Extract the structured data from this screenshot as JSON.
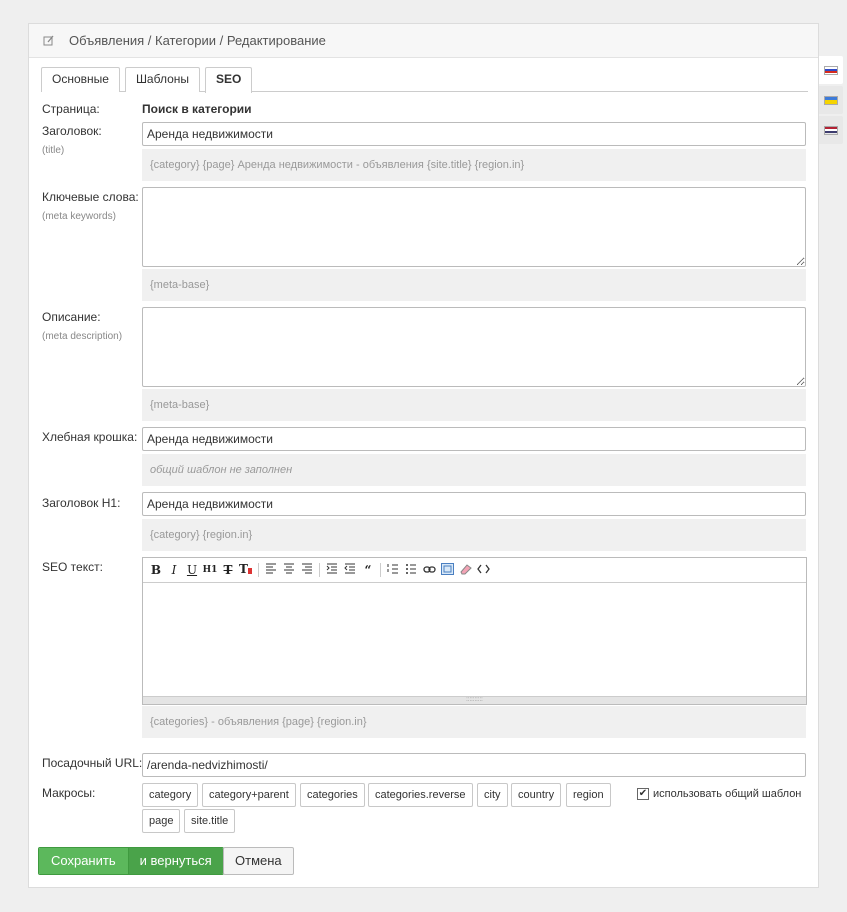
{
  "header": {
    "breadcrumb": "Объявления / Категории / Редактирование"
  },
  "tabs": [
    {
      "label": "Основные"
    },
    {
      "label": "Шаблоны"
    },
    {
      "label": "SEO",
      "active": true
    }
  ],
  "form": {
    "page": {
      "label": "Страница:",
      "value": "Поиск в категории"
    },
    "title": {
      "label": "Заголовок:",
      "sublabel": "(title)",
      "value": "Аренда недвижимости",
      "hint": "{category} {page} Аренда недвижимости - объявления {site.title} {region.in}"
    },
    "keywords": {
      "label": "Ключевые слова:",
      "sublabel": "(meta keywords)",
      "value": "",
      "hint": "{meta-base}"
    },
    "description": {
      "label": "Описание:",
      "sublabel": "(meta description)",
      "value": "",
      "hint": "{meta-base}"
    },
    "breadcrumb": {
      "label": "Хлебная крошка:",
      "value": "Аренда недвижимости",
      "hint": "общий шаблон не заполнен"
    },
    "h1": {
      "label": "Заголовок H1:",
      "value": "Аренда недвижимости",
      "hint": "{category} {region.in}"
    },
    "seo_text": {
      "label": "SEO текст:",
      "hint": "{categories} - объявления {page} {region.in}"
    },
    "url": {
      "label": "Посадочный URL:",
      "value": "/arenda-nedvizhimosti/"
    },
    "macros": {
      "label": "Макросы:",
      "items": [
        "category",
        "category+parent",
        "categories",
        "categories.reverse",
        "city",
        "country",
        "region",
        "page",
        "site.title"
      ],
      "use_common_label": "использовать общий шаблон",
      "use_common_checked": true
    }
  },
  "toolbar_icons": [
    "bold-icon",
    "italic-icon",
    "underline-icon",
    "heading-icon",
    "strikethrough-icon",
    "text-color-icon",
    "align-left-icon",
    "align-center-icon",
    "align-right-icon",
    "indent-icon",
    "outdent-icon",
    "quote-icon",
    "ordered-list-icon",
    "unordered-list-icon",
    "link-icon",
    "fullscreen-icon",
    "eraser-icon",
    "code-icon"
  ],
  "buttons": {
    "save": "Сохранить",
    "save_return": "и вернуться",
    "cancel": "Отмена"
  },
  "languages": [
    {
      "name": "ru",
      "colors": [
        "#ffffff",
        "#2f49c7",
        "#d52b1e"
      ],
      "active": true
    },
    {
      "name": "ua",
      "colors": [
        "#3d7bd9",
        "#f5d400"
      ]
    },
    {
      "name": "en",
      "colors": [
        "#b22234",
        "#ffffff",
        "#3c3b6e"
      ]
    }
  ]
}
